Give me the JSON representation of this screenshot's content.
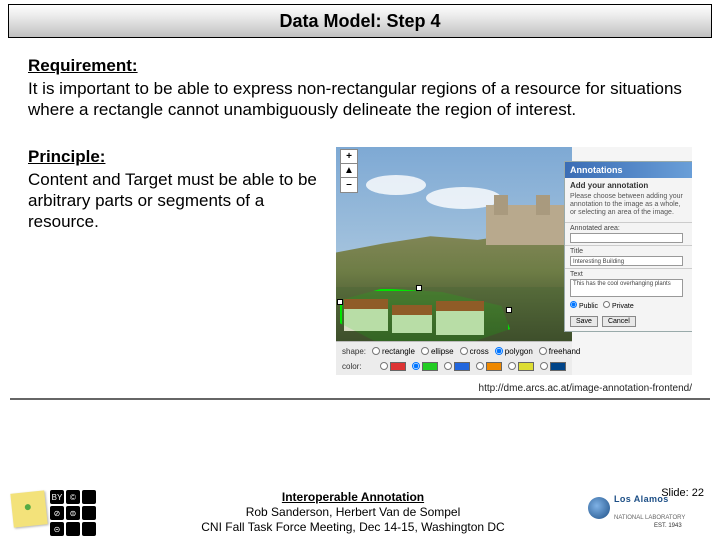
{
  "title": "Data Model: Step 4",
  "requirement": {
    "heading": "Requirement:",
    "body": "It is important to be able to express non-rectangular regions of a resource for situations where a rectangle cannot unambiguously delineate the region of interest."
  },
  "principle": {
    "heading": "Principle:",
    "body": "Content and Target must be able to be arbitrary parts or segments of a resource."
  },
  "figure": {
    "zoom": {
      "in": "+",
      "center": "▲",
      "out": "–"
    },
    "shapebar": {
      "shape_label": "shape:",
      "shapes": [
        "rectangle",
        "ellipse",
        "cross",
        "polygon",
        "freehand"
      ],
      "color_label": "color:",
      "colors": [
        "red",
        "green",
        "blue",
        "orange",
        "yellow",
        "dark"
      ]
    },
    "panel": {
      "title": "Annotations",
      "subtitle": "Add your annotation",
      "instruction": "Please choose between adding your annotation to the image as a whole, or selecting an area of the image.",
      "row_area": "Annotated area:",
      "row_title_lbl": "Title",
      "row_title_val": "Interesting Building",
      "row_text_lbl": "Text",
      "row_text_val": "This has the cool overhanging plants",
      "radio_public": "Public",
      "radio_private": "Private",
      "save": "Save",
      "cancel": "Cancel"
    },
    "source_url": "http://dme.arcs.ac.at/image-annotation-frontend/"
  },
  "footer": {
    "cc": [
      "BY",
      "©",
      "",
      "⊘",
      "⊜",
      "",
      "⊝",
      "",
      ""
    ],
    "title": "Interoperable Annotation",
    "authors": "Rob Sanderson, Herbert Van de Sompel",
    "venue": "CNI Fall Task Force Meeting, Dec 14-15, Washington DC",
    "lab_line1": "Los Alamos",
    "lab_line2": "NATIONAL LABORATORY",
    "lab_est": "EST. 1943",
    "slide": "Slide: 22"
  }
}
